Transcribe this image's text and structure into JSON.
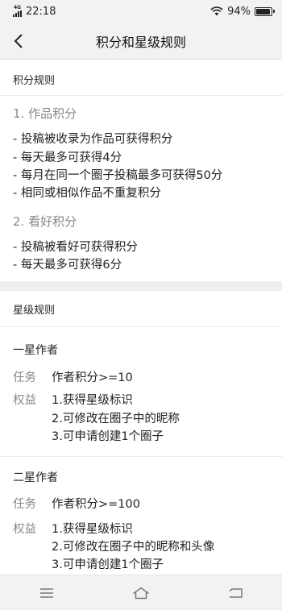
{
  "status_bar": {
    "network": "4G",
    "time": "22:18",
    "battery": "94%",
    "battery_level": 0.94
  },
  "header": {
    "title": "积分和星级规则"
  },
  "points_section": {
    "title": "积分规则",
    "works": {
      "heading": "1. 作品积分",
      "rules": [
        "- 投稿被收录为作品可获得积分",
        "- 每天最多可获得4分",
        "- 每月在同一个圈子投稿最多可获得50分",
        "- 相同或相似作品不重复积分"
      ]
    },
    "likes": {
      "heading": "2. 看好积分",
      "rules": [
        "- 投稿被看好可获得积分",
        "- 每天最多可获得6分"
      ]
    }
  },
  "star_section": {
    "title": "星级规则",
    "levels": [
      {
        "name": "一星作者",
        "task_label": "任务",
        "task": "作者积分>=10",
        "rights_label": "权益",
        "rights": [
          "1.获得星级标识",
          "2.可修改在圈子中的昵称",
          "3.可申请创建1个圈子"
        ]
      },
      {
        "name": "二星作者",
        "task_label": "任务",
        "task": "作者积分>=100",
        "rights_label": "权益",
        "rights": [
          "1.获得星级标识",
          "2.可修改在圈子中的昵称和头像",
          "3.可申请创建1个圈子"
        ]
      }
    ]
  },
  "nav_bar": {
    "icons": [
      "menu-icon",
      "home-icon",
      "back-icon"
    ]
  }
}
